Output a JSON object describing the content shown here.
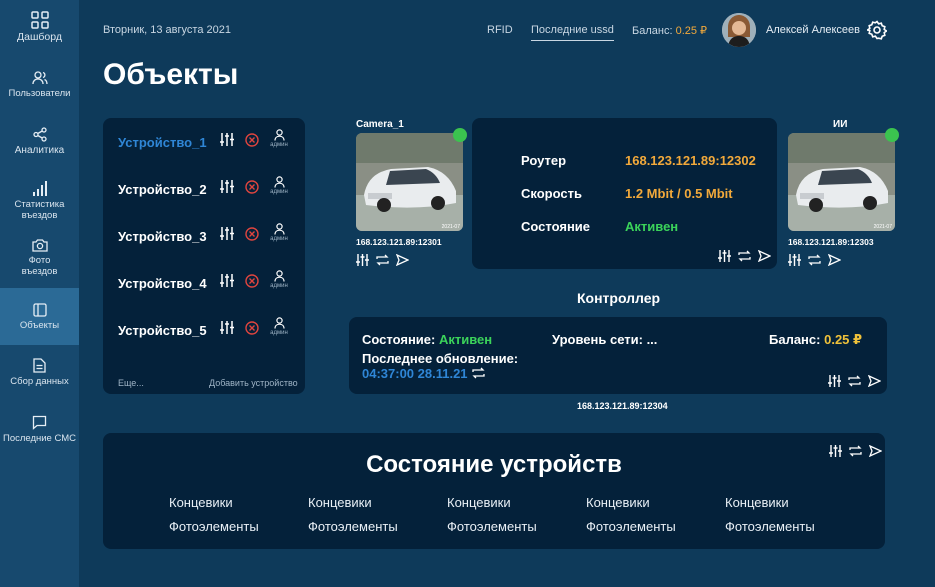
{
  "sidebar": {
    "items": [
      {
        "label": "Дашборд",
        "icon": "grid-icon"
      },
      {
        "label": "Пользователи",
        "icon": "users-icon"
      },
      {
        "label": "Аналитика",
        "icon": "share-icon"
      },
      {
        "label": "Статистика въездов",
        "line1": "Статистика",
        "line2": "въездов",
        "icon": "bar-chart-icon"
      },
      {
        "label": "Фото въездов",
        "line1": "Фото",
        "line2": "въездов",
        "icon": "camera-icon"
      },
      {
        "label": "Объекты",
        "icon": "layout-icon",
        "active": true
      },
      {
        "label": "Сбор данных",
        "icon": "document-icon"
      },
      {
        "label": "Последние СМС",
        "icon": "message-icon"
      }
    ]
  },
  "header": {
    "date": "Вторник, 13 августа 2021",
    "rfid": "RFID",
    "ussd": "Последние ussd",
    "balance_label": "Баланс:",
    "balance_value": "0.25 ₽",
    "user_name": "Алексей Алексеев"
  },
  "page_title": "Объекты",
  "devices": {
    "items": [
      {
        "name": "Устройство_1",
        "role": "админ",
        "selected": true
      },
      {
        "name": "Устройство_2",
        "role": "админ"
      },
      {
        "name": "Устройство_3",
        "role": "админ"
      },
      {
        "name": "Устройство_4",
        "role": "админ"
      },
      {
        "name": "Устройство_5",
        "role": "админ"
      }
    ],
    "more": "Еще...",
    "add": "Добавить устройство"
  },
  "camera_left": {
    "title": "Camera_1",
    "ip": "168.123.121.89:12301",
    "stamp": "2021-07"
  },
  "camera_right": {
    "title": "ИИ",
    "ip": "168.123.121.89:12303",
    "stamp": "2021-07"
  },
  "router": {
    "router_label": "Роутер",
    "router_value": "168.123.121.89:12302",
    "speed_label": "Скорость",
    "speed_value": "1.2 Mbit / 0.5 Mbit",
    "state_label": "Состояние",
    "state_value": "Активен"
  },
  "controller": {
    "title": "Контроллер",
    "state_label": "Состояние:",
    "state_value": "Активен",
    "network_label": "Уровень сети: ...",
    "balance_label": "Баланс:",
    "balance_value": "0.25 ₽",
    "update_label": "Последнее обновление:",
    "update_value": "04:37:00 28.11.21",
    "ip": "168.123.121.89:12304"
  },
  "device_state": {
    "title": "Состояние устройств",
    "columns": [
      {
        "a": "Концевики",
        "b": "Фотоэлементы"
      },
      {
        "a": "Концевики",
        "b": "Фотоэлементы"
      },
      {
        "a": "Концевики",
        "b": "Фотоэлементы"
      },
      {
        "a": "Концевики",
        "b": "Фотоэлементы"
      },
      {
        "a": "Концевики",
        "b": "Фотоэлементы"
      }
    ]
  },
  "colors": {
    "bg": "#0e3a5a",
    "sidebar": "#17496e",
    "active": "#2b6a96",
    "panel": "#04213a",
    "accent_orange": "#f2a93b",
    "status_green": "#3bd35a",
    "link_blue": "#2f86d6"
  }
}
